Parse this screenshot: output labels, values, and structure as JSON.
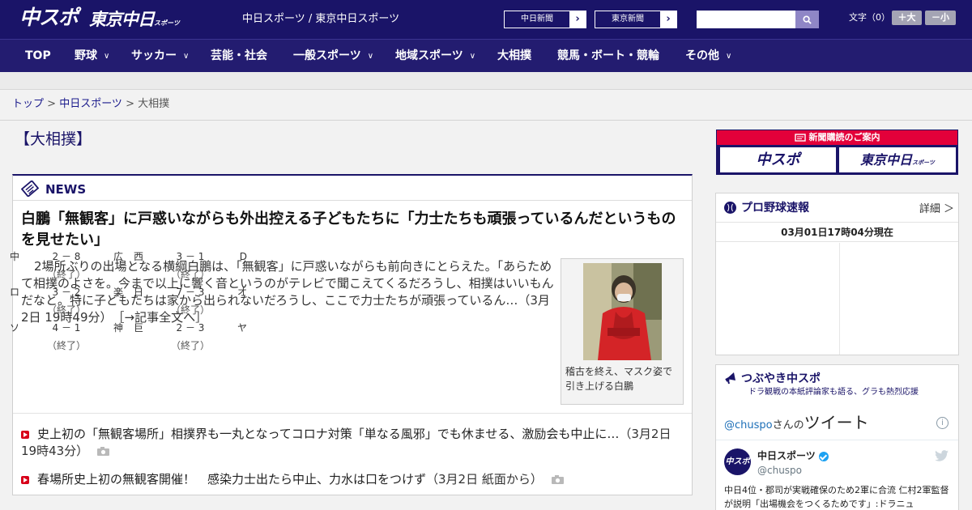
{
  "header": {
    "logo_chunichi_sports": "中スポ",
    "logo_tokyo_chunichi": "東京中日",
    "logo_tokyo_chunichi_suffix": "スポーツ",
    "site_names": "中日スポーツ / 東京中日スポーツ",
    "link_chunichi_shimbun": "中日新聞",
    "link_tokyo_shimbun": "東京新聞",
    "search_placeholder": "",
    "font_size_label": "文字（0）",
    "font_larger": "＋大",
    "font_smaller": "－小"
  },
  "nav": {
    "items": [
      {
        "label": "TOP"
      },
      {
        "label": "野球"
      },
      {
        "label": "サッカー"
      },
      {
        "label": "芸能・社会"
      },
      {
        "label": "一般スポーツ"
      },
      {
        "label": "地域スポーツ"
      },
      {
        "label": "大相撲"
      },
      {
        "label": "競馬・ボート・競輪"
      },
      {
        "label": "その他"
      }
    ]
  },
  "breadcrumb": {
    "top": "トップ",
    "sep": " > ",
    "section": "中日スポーツ",
    "current": "大相撲"
  },
  "page_title": "【大相撲】",
  "news": {
    "label": "NEWS",
    "headline": "白鵬「無観客」に戸惑いながらも外出控える子どもたちに「力士たちも頑張っているんだというものを見せたい」",
    "lead": "2場所ぶりの出場となる横綱白鵬は、「無観客」に戸惑いながらも前向きにとらえた。「あらためて相撲のよさを。今まで以上に響く音というのがテレビで聞こえてくるだろうし、相撲はいいもんだなと。特に子どもたちは家から出られないだろうし、ここで力士たちが頑張っているん…（3月2日 19時49分）",
    "more_link": "［→記事全文へ］",
    "photo_caption": "稽古を終え、マスク姿で引き上げる白鵬",
    "items": [
      {
        "title": "史上初の「無観客場所」相撲界も一丸となってコロナ対策「単なる風邪」でも休ませる、激励会も中止に…",
        "date": "（3月2日 19時43分）"
      },
      {
        "title": "春場所史上初の無観客開催！　感染力士出たら中止、力水は口をつけず",
        "date": "（3月2日 紙面から）"
      }
    ]
  },
  "subscribe": {
    "title": "新聞購読のご案内",
    "btn1": "中スポ",
    "btn2": "東京中日",
    "btn2_suffix": "スポーツ"
  },
  "scores": {
    "title": "プロ野球速報",
    "detail": "詳細 ＞",
    "timestamp": "03月01日17時04分現在",
    "games": [
      {
        "home": "中",
        "score": "2 － 8",
        "away": "広",
        "status": "（終了）"
      },
      {
        "home": "西",
        "score": "3 － 1",
        "away": "D",
        "status": "（終了）"
      },
      {
        "home": "ロ",
        "score": "3 － 2",
        "away": "楽",
        "status": "（終了）"
      },
      {
        "home": "日",
        "score": "7 － 3",
        "away": "オ",
        "status": "（終了）"
      },
      {
        "home": "ソ",
        "score": "4 － 1",
        "away": "神",
        "status": "（終了）"
      },
      {
        "home": "巨",
        "score": "2 － 3",
        "away": "ヤ",
        "status": "（終了）"
      }
    ]
  },
  "twitter": {
    "title": "つぶやき中スポ",
    "subtitle": "ドラ観戦の本紙評論家も語る、グラも熱烈応援",
    "handle_link": "@chuspo",
    "san": "さんの",
    "tweets_label": "ツイート",
    "user_name": "中日スポーツ",
    "user_handle": "@chuspo",
    "avatar_text": "中スポ",
    "tweet_text": "中日4位・郡司が実戦確保のため2軍に合流 仁村2軍監督が説明「出場機会をつくるためです」:ドラニュ"
  },
  "colors": {
    "header_bg": "#1a1468",
    "nav_bg": "#231c70",
    "accent_red": "#d8001a",
    "subscribe_red": "#e3003a"
  }
}
